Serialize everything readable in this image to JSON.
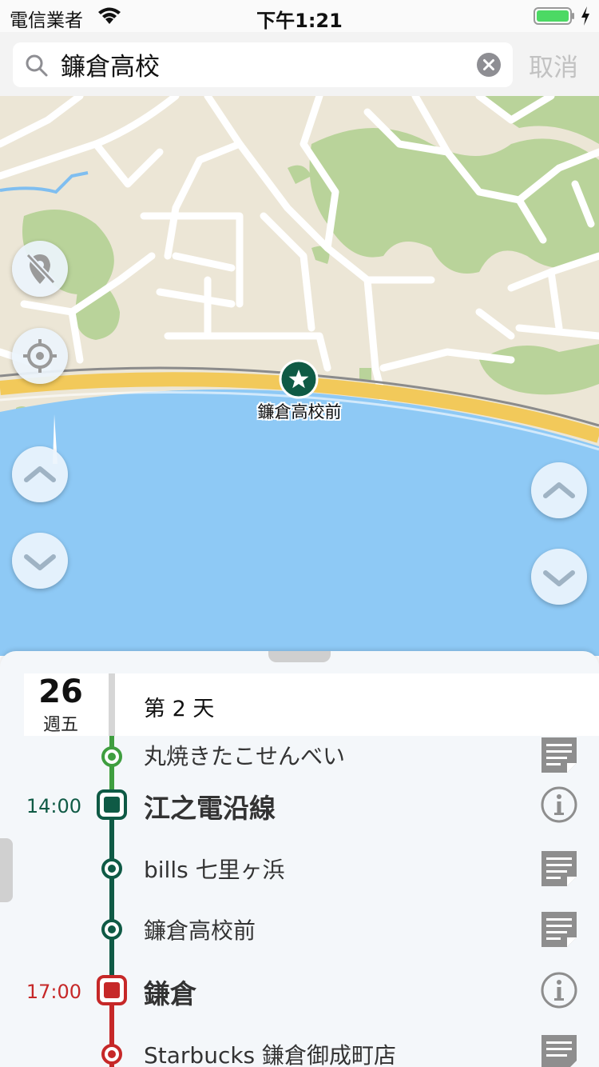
{
  "status_bar": {
    "carrier": "電信業者",
    "time": "下午1:21"
  },
  "search": {
    "value": "鐮倉高校",
    "cancel_label": "取消"
  },
  "map": {
    "marker_label": "鐮倉高校前"
  },
  "sheet": {
    "day_number": "26",
    "day_of_week": "週五",
    "day_label": "第 2 天",
    "items": [
      {
        "name": "丸焼きたこせんべい",
        "type": "place",
        "color": "#3f9e3f",
        "icon": "notes-icon"
      },
      {
        "time": "14:00",
        "name": "江之電沿線",
        "type": "area",
        "color": "#0f5a45",
        "icon": "info-icon"
      },
      {
        "name": "bills 七里ヶ浜",
        "type": "place",
        "color": "#0f5a45",
        "icon": "notes-icon"
      },
      {
        "name": "鐮倉高校前",
        "type": "place",
        "color": "#0f5a45",
        "icon": "notes-icon"
      },
      {
        "time": "17:00",
        "name": "鎌倉",
        "type": "area",
        "color": "#c62828",
        "icon": "info-icon"
      },
      {
        "name": "Starbucks 鎌倉御成町店",
        "type": "place",
        "color": "#c62828",
        "icon": "notes-icon"
      }
    ]
  },
  "colors": {
    "land": "#ece6d6",
    "park": "#b9d39a",
    "water": "#8ec9f5",
    "road": "#ffffff",
    "highway": "#f2c95a",
    "green_dark": "#0f5a45",
    "green_light": "#3f9e3f",
    "red": "#c62828"
  }
}
